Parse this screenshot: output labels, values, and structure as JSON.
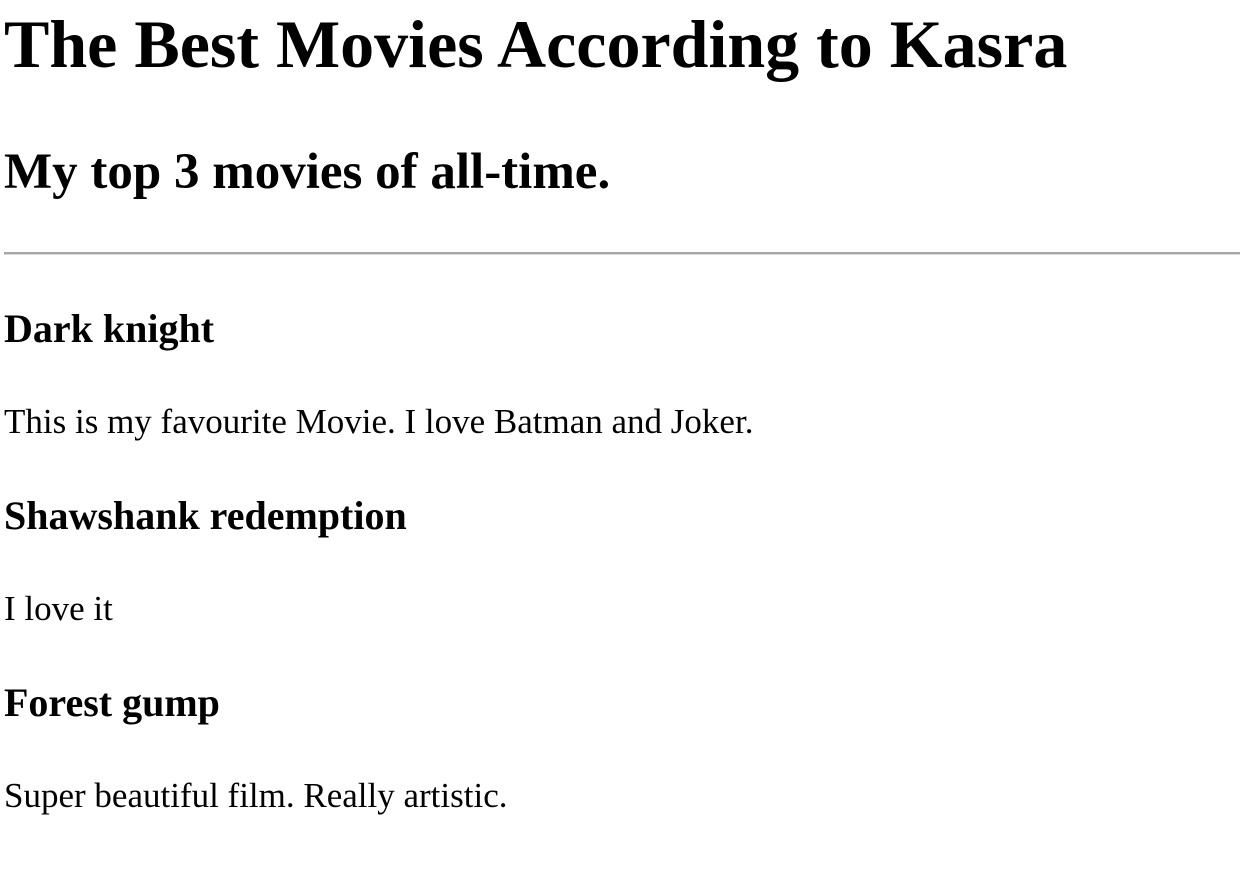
{
  "page": {
    "title": "The Best Movies According to Kasra",
    "subtitle": "My top 3 movies of all-time."
  },
  "movies": [
    {
      "title": "Dark knight",
      "description": "This is my favourite Movie. I love Batman and Joker."
    },
    {
      "title": "Shawshank redemption",
      "description": "I love it"
    },
    {
      "title": "Forest gump",
      "description": "Super beautiful film. Really artistic."
    }
  ]
}
